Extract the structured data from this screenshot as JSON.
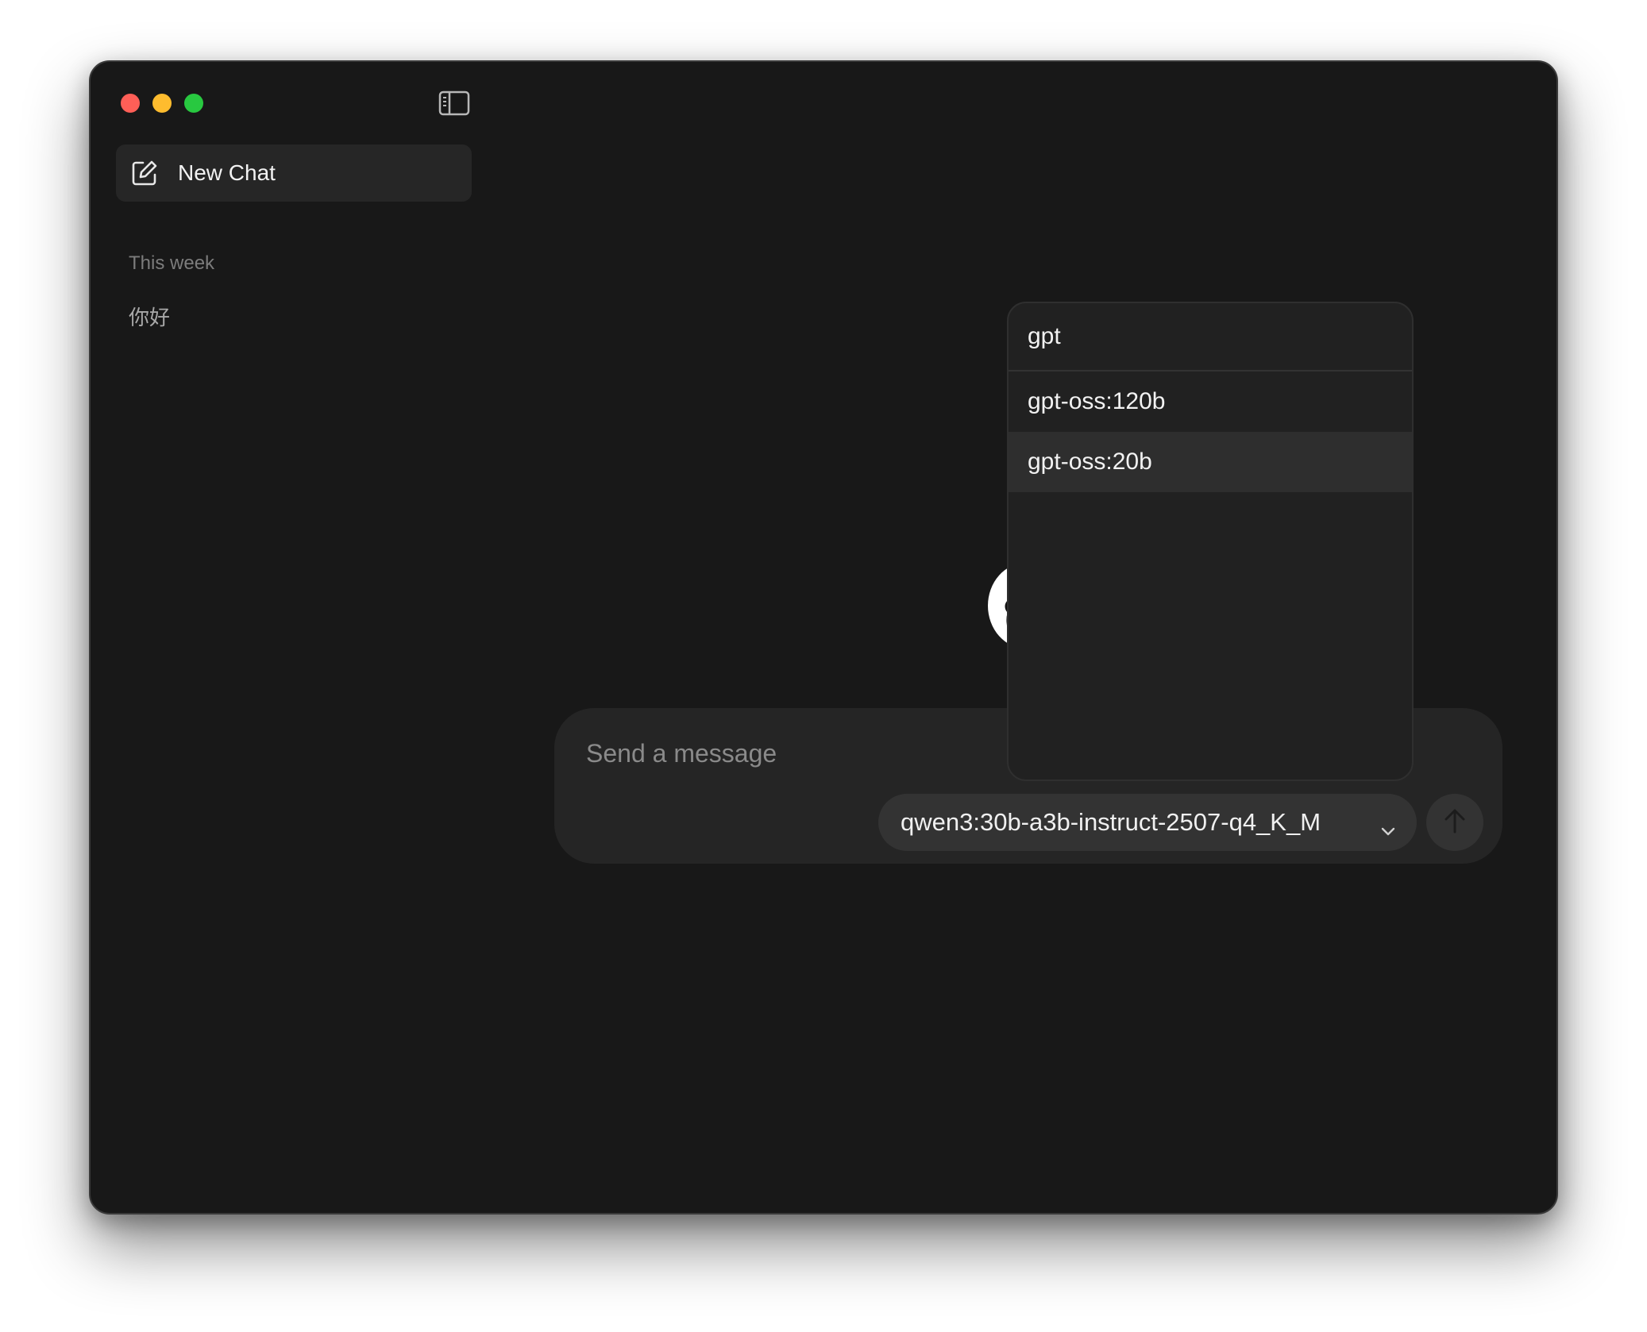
{
  "sidebar": {
    "new_chat_label": "New Chat",
    "section_label": "This week",
    "chats": [
      "你好"
    ]
  },
  "composer": {
    "placeholder": "Send a message",
    "selected_model": "qwen3:30b-a3b-instruct-2507-q4_K_M"
  },
  "model_dropdown": {
    "search_value": "gpt",
    "options": [
      "gpt-oss:120b",
      "gpt-oss:20b"
    ],
    "highlighted_index": 1
  },
  "colors": {
    "window_bg": "#181818",
    "sidebar_button_bg": "#262626",
    "composer_bg": "#252525",
    "dropdown_bg": "#212121",
    "close": "#ff5f57",
    "minimize": "#febc2e",
    "maximize": "#28c840"
  },
  "icons": {
    "new_chat": "compose-icon",
    "sidebar_toggle": "sidebar-toggle-icon",
    "send": "arrow-up-icon",
    "model_select": "chevron-down-icon",
    "logo": "llama-logo-icon"
  }
}
